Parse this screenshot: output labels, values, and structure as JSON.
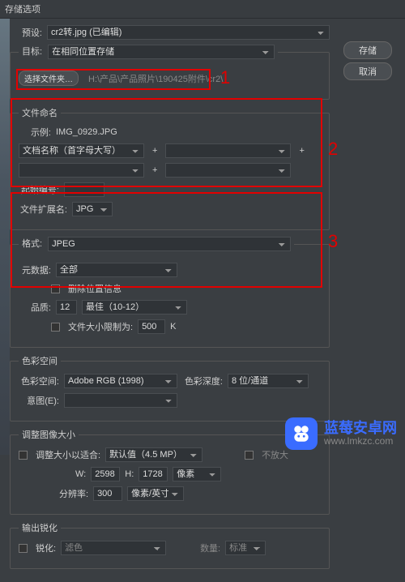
{
  "window": {
    "title": "存储选项"
  },
  "preset": {
    "label": "预设:",
    "value": "cr2转.jpg (已编辑)"
  },
  "target": {
    "legend": "目标:",
    "mode": "在相同位置存储",
    "choose_btn": "选择文件夹…",
    "path": "H:\\产品\\产品照片\\190425附件\\cr2\\"
  },
  "naming": {
    "legend": "文件命名",
    "example_label": "示例:",
    "example_value": "IMG_0929.JPG",
    "template_a": "文档名称（首字母大写）",
    "template_b": "",
    "template_c": "",
    "template_d": "",
    "start_label": "起始编号:",
    "ext_label": "文件扩展名:",
    "ext_value": "JPG"
  },
  "format": {
    "legend": "格式:",
    "value": "JPEG",
    "meta_label": "元数据:",
    "meta_value": "全部",
    "strip_loc": "删除位置信息",
    "quality_label": "品质:",
    "quality_num": "12",
    "quality_desc": "最佳（10-12）",
    "limit_label": "文件大小限制为:",
    "limit_val": "500",
    "limit_unit": "K"
  },
  "colorspace": {
    "legend": "色彩空间",
    "space_label": "色彩空间:",
    "space_value": "Adobe RGB (1998)",
    "depth_label": "色彩深度:",
    "depth_value": "8 位/通道",
    "intent_label": "意图(E):"
  },
  "resize": {
    "legend": "调整图像大小",
    "fit_label": "调整大小以适合:",
    "fit_value": "默认值（4.5 MP）",
    "no_enlarge": "不放大",
    "w_label": "W:",
    "w_val": "2598",
    "h_label": "H:",
    "h_val": "1728",
    "unit": "像素",
    "res_label": "分辨率:",
    "res_val": "300",
    "res_unit": "像素/英寸"
  },
  "sharpen": {
    "legend": "输出锐化",
    "enable": "锐化:",
    "for_value": "滤色",
    "amount_label": "数量:",
    "amount_value": "标准"
  },
  "buttons": {
    "save": "存储",
    "cancel": "取消"
  },
  "annotations": {
    "n1": "1",
    "n2": "2",
    "n3": "3"
  },
  "watermark": {
    "title": "蓝莓安卓网",
    "url": "www.lmkzc.com"
  }
}
